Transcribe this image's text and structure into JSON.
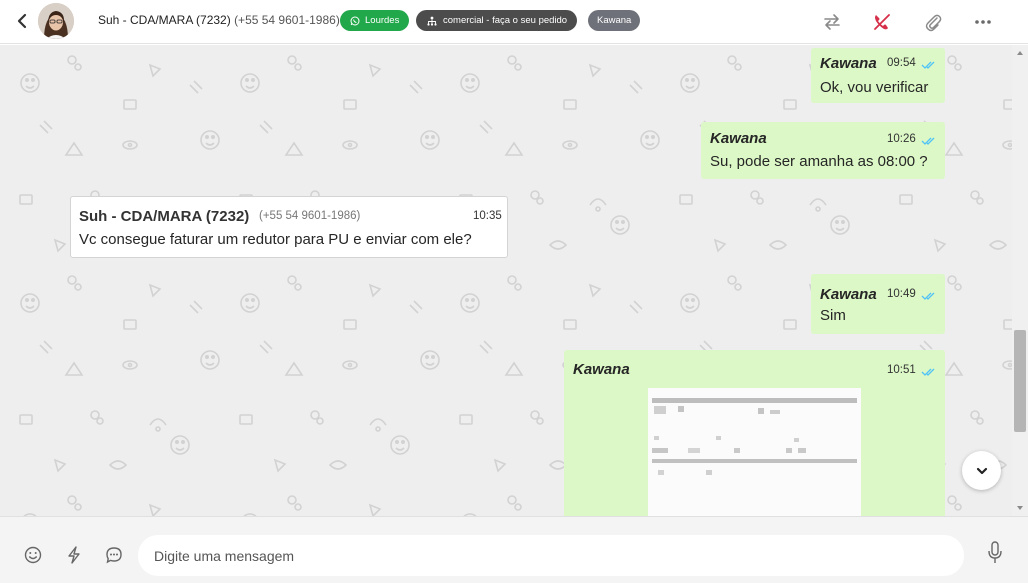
{
  "header": {
    "contact_name": "Suh - CDA/MARA (7232)",
    "contact_phone": "(+55 54 9601-1986)",
    "tags": [
      {
        "label": "Lourdes",
        "icon": "whatsapp-icon",
        "color": "#21a84a"
      },
      {
        "label": "comercial - faça o seu pedido",
        "icon": "sitemap-icon",
        "color": "#4c4c4c"
      },
      {
        "label": "Kawana",
        "color": "#6e7179"
      }
    ],
    "icons": [
      "transfer-icon",
      "end-call-icon",
      "attach-icon",
      "more-icon"
    ]
  },
  "messages": [
    {
      "direction": "out",
      "sender": "Kawana",
      "time": "09:54",
      "text": "Ok, vou verificar",
      "status": "read"
    },
    {
      "direction": "out",
      "sender": "Kawana",
      "time": "10:26",
      "text": "Su, pode ser amanha as 08:00 ?",
      "status": "read"
    },
    {
      "direction": "in",
      "sender": "Suh - CDA/MARA (7232)",
      "phone": "(+55 54 9601-1986)",
      "time": "10:35",
      "text": "Vc consegue faturar um redutor para PU e enviar com ele?"
    },
    {
      "direction": "out",
      "sender": "Kawana",
      "time": "10:49",
      "text": "Sim",
      "status": "read"
    },
    {
      "direction": "out",
      "sender": "Kawana",
      "time": "10:51",
      "text": "",
      "attachment": "image",
      "status": "read"
    }
  ],
  "composer": {
    "placeholder": "Digite uma mensagem",
    "icons": [
      "emoji-icon",
      "quick-reply-icon",
      "templates-icon",
      "microphone-icon"
    ]
  },
  "colors": {
    "outgoing_bubble": "#dcf8c6",
    "incoming_bubble": "#ffffff",
    "chat_background": "#eeeeee",
    "read_ticks": "#4fc3f7"
  }
}
